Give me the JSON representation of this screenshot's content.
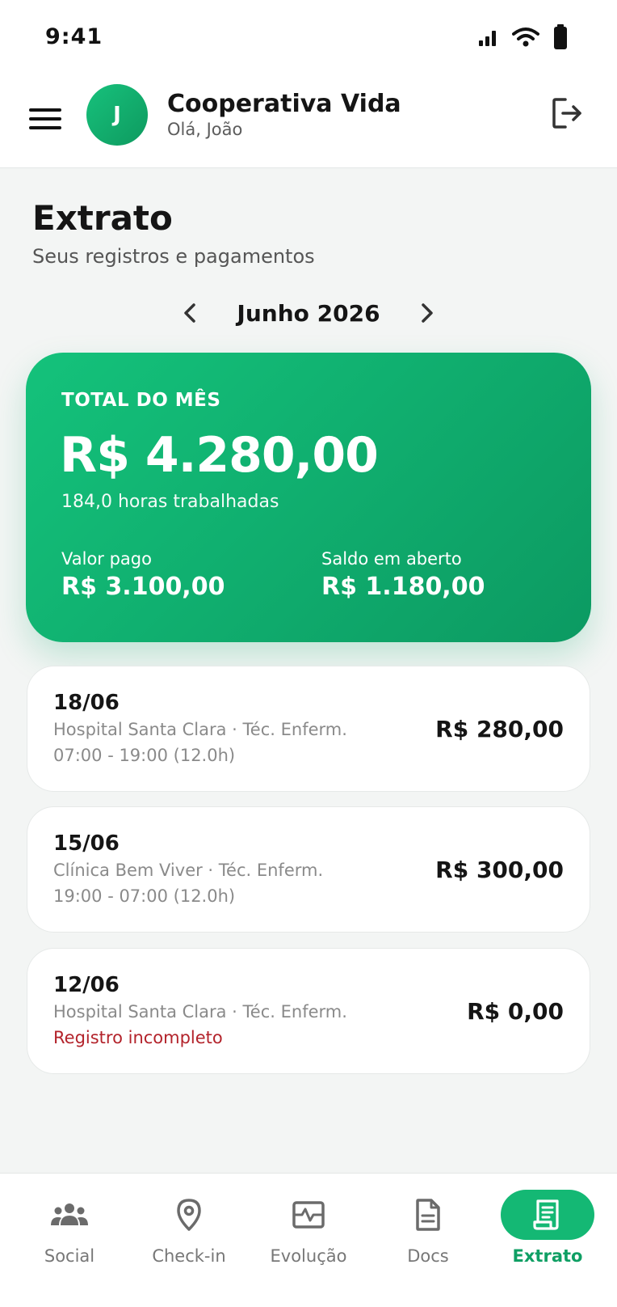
{
  "status_bar": {
    "time": "9:41"
  },
  "header": {
    "avatar_initial": "J",
    "org_name": "Cooperativa Vida",
    "greeting": "Olá, João"
  },
  "page": {
    "title": "Extrato",
    "subtitle": "Seus registros e pagamentos"
  },
  "month_nav": {
    "label": "Junho 2026"
  },
  "summary": {
    "label": "TOTAL DO MÊS",
    "total": "R$ 4.280,00",
    "hours": "184,0 horas trabalhadas",
    "paid_label": "Valor pago",
    "paid_value": "R$ 3.100,00",
    "open_label": "Saldo em aberto",
    "open_value": "R$ 1.180,00"
  },
  "records": [
    {
      "date": "18/06",
      "place": "Hospital Santa Clara · Téc. Enferm.",
      "time": "07:00 - 19:00 (12.0h)",
      "amount": "R$ 280,00"
    },
    {
      "date": "15/06",
      "place": "Clínica Bem Viver · Téc. Enferm.",
      "time": "19:00 - 07:00 (12.0h)",
      "amount": "R$ 300,00"
    },
    {
      "date": "12/06",
      "place": "Hospital Santa Clara · Téc. Enferm.",
      "warning": "Registro incompleto",
      "amount": "R$ 0,00"
    }
  ],
  "bottom_nav": {
    "items": [
      {
        "label": "Social",
        "icon": "people-icon"
      },
      {
        "label": "Check-in",
        "icon": "location-pin-icon"
      },
      {
        "label": "Evolução",
        "icon": "activity-icon"
      },
      {
        "label": "Docs",
        "icon": "document-icon"
      },
      {
        "label": "Extrato",
        "icon": "receipt-icon"
      }
    ],
    "active": "Extrato"
  },
  "colors": {
    "accent": "#14b874",
    "accent_dark": "#0c9a62",
    "warning": "#b3232b"
  }
}
